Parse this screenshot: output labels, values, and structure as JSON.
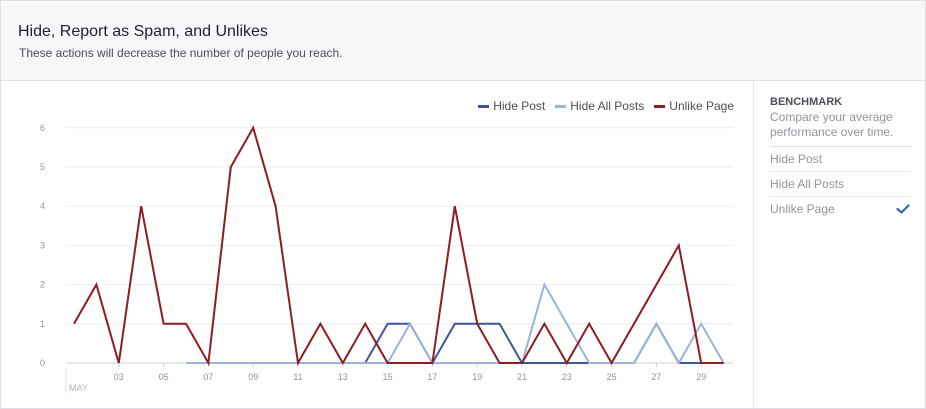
{
  "header": {
    "title": "Hide, Report as Spam, and Unlikes",
    "subtitle": "These actions will decrease the number of people you reach."
  },
  "benchmark": {
    "title": "BENCHMARK",
    "description": "Compare your average performance over time.",
    "items": [
      {
        "label": "Hide Post",
        "selected": false
      },
      {
        "label": "Hide All Posts",
        "selected": false
      },
      {
        "label": "Unlike Page",
        "selected": true
      }
    ],
    "check_color": "#4267b2"
  },
  "chart_data": {
    "type": "line",
    "x_start_day": 1,
    "month_label": "MAY",
    "x": [
      1,
      2,
      3,
      4,
      5,
      6,
      7,
      8,
      9,
      10,
      11,
      12,
      13,
      14,
      15,
      16,
      17,
      18,
      19,
      20,
      21,
      22,
      23,
      24,
      25,
      26,
      27,
      28,
      29,
      30,
      31
    ],
    "xtick_labels": [
      "03",
      "05",
      "07",
      "09",
      "11",
      "13",
      "15",
      "17",
      "19",
      "21",
      "23",
      "25",
      "27",
      "29"
    ],
    "xtick_days": [
      3,
      5,
      7,
      9,
      11,
      13,
      15,
      17,
      19,
      21,
      23,
      25,
      27,
      29
    ],
    "ylim": [
      0,
      6
    ],
    "yticks": [
      0,
      1,
      2,
      3,
      4,
      5,
      6
    ],
    "grid": true,
    "legend_position": "top-right",
    "series": [
      {
        "name": "Hide Post",
        "color": "#3b5998",
        "values": [
          null,
          null,
          null,
          null,
          null,
          0,
          0,
          0,
          0,
          0,
          0,
          0,
          0,
          0,
          1,
          1,
          0,
          1,
          1,
          1,
          0,
          0,
          0,
          0,
          0,
          0,
          1,
          0,
          0,
          0,
          null
        ]
      },
      {
        "name": "Hide All Posts",
        "color": "#9cb4d8",
        "values": [
          null,
          null,
          null,
          null,
          null,
          0,
          0,
          0,
          0,
          0,
          0,
          0,
          0,
          0,
          0,
          1,
          0,
          0,
          0,
          0,
          0,
          2,
          1,
          0,
          0,
          0,
          1,
          0,
          1,
          0,
          null
        ]
      },
      {
        "name": "Unlike Page",
        "color": "#8b1d24",
        "values": [
          1,
          2,
          0,
          4,
          1,
          1,
          0,
          5,
          6,
          4,
          0,
          1,
          0,
          1,
          0,
          0,
          0,
          4,
          1,
          0,
          0,
          1,
          0,
          1,
          0,
          1,
          2,
          3,
          0,
          0,
          null
        ]
      }
    ]
  }
}
